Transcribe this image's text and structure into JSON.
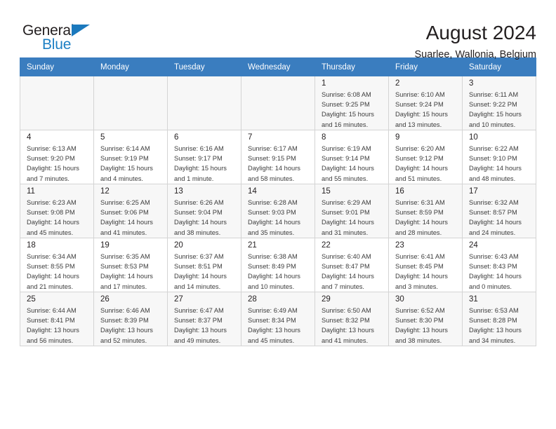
{
  "brand": {
    "name_part1": "General",
    "name_part2": "Blue",
    "mark": "triangle-logo-icon",
    "color_dark": "#231f20",
    "color_blue": "#1c7fc4"
  },
  "header": {
    "title": "August 2024",
    "subtitle": "Suarlee, Wallonia, Belgium"
  },
  "theme": {
    "header_row_bg": "#3a7dbf",
    "header_row_text": "#ffffff",
    "grid_border": "#d4d4d4",
    "row_shaded_bg": "#f7f7f7",
    "cell_bg": "#ffffff"
  },
  "weekdays": [
    "Sunday",
    "Monday",
    "Tuesday",
    "Wednesday",
    "Thursday",
    "Friday",
    "Saturday"
  ],
  "labels": {
    "sunrise_prefix": "Sunrise:",
    "sunset_prefix": "Sunset:",
    "daylight_prefix": "Daylight:"
  },
  "weeks": [
    [
      {
        "day": "",
        "sunrise": "",
        "sunset": "",
        "daylight_line1": "",
        "daylight_line2": ""
      },
      {
        "day": "",
        "sunrise": "",
        "sunset": "",
        "daylight_line1": "",
        "daylight_line2": ""
      },
      {
        "day": "",
        "sunrise": "",
        "sunset": "",
        "daylight_line1": "",
        "daylight_line2": ""
      },
      {
        "day": "",
        "sunrise": "",
        "sunset": "",
        "daylight_line1": "",
        "daylight_line2": ""
      },
      {
        "day": "1",
        "sunrise": "Sunrise: 6:08 AM",
        "sunset": "Sunset: 9:25 PM",
        "daylight_line1": "Daylight: 15 hours",
        "daylight_line2": "and 16 minutes."
      },
      {
        "day": "2",
        "sunrise": "Sunrise: 6:10 AM",
        "sunset": "Sunset: 9:24 PM",
        "daylight_line1": "Daylight: 15 hours",
        "daylight_line2": "and 13 minutes."
      },
      {
        "day": "3",
        "sunrise": "Sunrise: 6:11 AM",
        "sunset": "Sunset: 9:22 PM",
        "daylight_line1": "Daylight: 15 hours",
        "daylight_line2": "and 10 minutes."
      }
    ],
    [
      {
        "day": "4",
        "sunrise": "Sunrise: 6:13 AM",
        "sunset": "Sunset: 9:20 PM",
        "daylight_line1": "Daylight: 15 hours",
        "daylight_line2": "and 7 minutes."
      },
      {
        "day": "5",
        "sunrise": "Sunrise: 6:14 AM",
        "sunset": "Sunset: 9:19 PM",
        "daylight_line1": "Daylight: 15 hours",
        "daylight_line2": "and 4 minutes."
      },
      {
        "day": "6",
        "sunrise": "Sunrise: 6:16 AM",
        "sunset": "Sunset: 9:17 PM",
        "daylight_line1": "Daylight: 15 hours",
        "daylight_line2": "and 1 minute."
      },
      {
        "day": "7",
        "sunrise": "Sunrise: 6:17 AM",
        "sunset": "Sunset: 9:15 PM",
        "daylight_line1": "Daylight: 14 hours",
        "daylight_line2": "and 58 minutes."
      },
      {
        "day": "8",
        "sunrise": "Sunrise: 6:19 AM",
        "sunset": "Sunset: 9:14 PM",
        "daylight_line1": "Daylight: 14 hours",
        "daylight_line2": "and 55 minutes."
      },
      {
        "day": "9",
        "sunrise": "Sunrise: 6:20 AM",
        "sunset": "Sunset: 9:12 PM",
        "daylight_line1": "Daylight: 14 hours",
        "daylight_line2": "and 51 minutes."
      },
      {
        "day": "10",
        "sunrise": "Sunrise: 6:22 AM",
        "sunset": "Sunset: 9:10 PM",
        "daylight_line1": "Daylight: 14 hours",
        "daylight_line2": "and 48 minutes."
      }
    ],
    [
      {
        "day": "11",
        "sunrise": "Sunrise: 6:23 AM",
        "sunset": "Sunset: 9:08 PM",
        "daylight_line1": "Daylight: 14 hours",
        "daylight_line2": "and 45 minutes."
      },
      {
        "day": "12",
        "sunrise": "Sunrise: 6:25 AM",
        "sunset": "Sunset: 9:06 PM",
        "daylight_line1": "Daylight: 14 hours",
        "daylight_line2": "and 41 minutes."
      },
      {
        "day": "13",
        "sunrise": "Sunrise: 6:26 AM",
        "sunset": "Sunset: 9:04 PM",
        "daylight_line1": "Daylight: 14 hours",
        "daylight_line2": "and 38 minutes."
      },
      {
        "day": "14",
        "sunrise": "Sunrise: 6:28 AM",
        "sunset": "Sunset: 9:03 PM",
        "daylight_line1": "Daylight: 14 hours",
        "daylight_line2": "and 35 minutes."
      },
      {
        "day": "15",
        "sunrise": "Sunrise: 6:29 AM",
        "sunset": "Sunset: 9:01 PM",
        "daylight_line1": "Daylight: 14 hours",
        "daylight_line2": "and 31 minutes."
      },
      {
        "day": "16",
        "sunrise": "Sunrise: 6:31 AM",
        "sunset": "Sunset: 8:59 PM",
        "daylight_line1": "Daylight: 14 hours",
        "daylight_line2": "and 28 minutes."
      },
      {
        "day": "17",
        "sunrise": "Sunrise: 6:32 AM",
        "sunset": "Sunset: 8:57 PM",
        "daylight_line1": "Daylight: 14 hours",
        "daylight_line2": "and 24 minutes."
      }
    ],
    [
      {
        "day": "18",
        "sunrise": "Sunrise: 6:34 AM",
        "sunset": "Sunset: 8:55 PM",
        "daylight_line1": "Daylight: 14 hours",
        "daylight_line2": "and 21 minutes."
      },
      {
        "day": "19",
        "sunrise": "Sunrise: 6:35 AM",
        "sunset": "Sunset: 8:53 PM",
        "daylight_line1": "Daylight: 14 hours",
        "daylight_line2": "and 17 minutes."
      },
      {
        "day": "20",
        "sunrise": "Sunrise: 6:37 AM",
        "sunset": "Sunset: 8:51 PM",
        "daylight_line1": "Daylight: 14 hours",
        "daylight_line2": "and 14 minutes."
      },
      {
        "day": "21",
        "sunrise": "Sunrise: 6:38 AM",
        "sunset": "Sunset: 8:49 PM",
        "daylight_line1": "Daylight: 14 hours",
        "daylight_line2": "and 10 minutes."
      },
      {
        "day": "22",
        "sunrise": "Sunrise: 6:40 AM",
        "sunset": "Sunset: 8:47 PM",
        "daylight_line1": "Daylight: 14 hours",
        "daylight_line2": "and 7 minutes."
      },
      {
        "day": "23",
        "sunrise": "Sunrise: 6:41 AM",
        "sunset": "Sunset: 8:45 PM",
        "daylight_line1": "Daylight: 14 hours",
        "daylight_line2": "and 3 minutes."
      },
      {
        "day": "24",
        "sunrise": "Sunrise: 6:43 AM",
        "sunset": "Sunset: 8:43 PM",
        "daylight_line1": "Daylight: 14 hours",
        "daylight_line2": "and 0 minutes."
      }
    ],
    [
      {
        "day": "25",
        "sunrise": "Sunrise: 6:44 AM",
        "sunset": "Sunset: 8:41 PM",
        "daylight_line1": "Daylight: 13 hours",
        "daylight_line2": "and 56 minutes."
      },
      {
        "day": "26",
        "sunrise": "Sunrise: 6:46 AM",
        "sunset": "Sunset: 8:39 PM",
        "daylight_line1": "Daylight: 13 hours",
        "daylight_line2": "and 52 minutes."
      },
      {
        "day": "27",
        "sunrise": "Sunrise: 6:47 AM",
        "sunset": "Sunset: 8:37 PM",
        "daylight_line1": "Daylight: 13 hours",
        "daylight_line2": "and 49 minutes."
      },
      {
        "day": "28",
        "sunrise": "Sunrise: 6:49 AM",
        "sunset": "Sunset: 8:34 PM",
        "daylight_line1": "Daylight: 13 hours",
        "daylight_line2": "and 45 minutes."
      },
      {
        "day": "29",
        "sunrise": "Sunrise: 6:50 AM",
        "sunset": "Sunset: 8:32 PM",
        "daylight_line1": "Daylight: 13 hours",
        "daylight_line2": "and 41 minutes."
      },
      {
        "day": "30",
        "sunrise": "Sunrise: 6:52 AM",
        "sunset": "Sunset: 8:30 PM",
        "daylight_line1": "Daylight: 13 hours",
        "daylight_line2": "and 38 minutes."
      },
      {
        "day": "31",
        "sunrise": "Sunrise: 6:53 AM",
        "sunset": "Sunset: 8:28 PM",
        "daylight_line1": "Daylight: 13 hours",
        "daylight_line2": "and 34 minutes."
      }
    ]
  ]
}
